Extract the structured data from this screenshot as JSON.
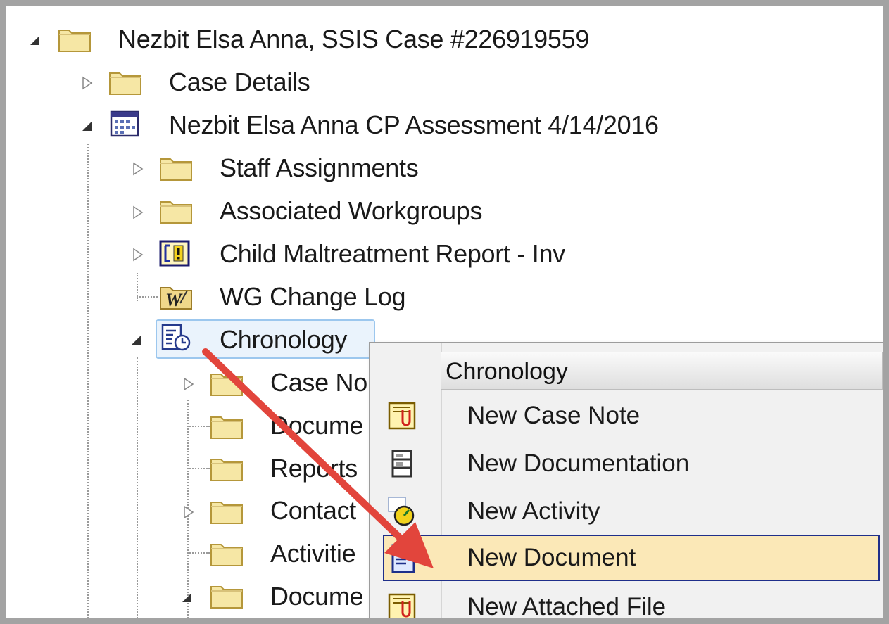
{
  "tree": {
    "items": [
      {
        "label": "Nezbit Elsa Anna, SSIS Case #226919559",
        "icon": "folder-icon",
        "expander": "expanded"
      },
      {
        "label": "Case Details",
        "icon": "folder-icon",
        "expander": "collapsed"
      },
      {
        "label": "Nezbit Elsa Anna CP Assessment 4/14/2016",
        "icon": "assessment-icon",
        "expander": "expanded"
      },
      {
        "label": "Staff Assignments",
        "icon": "folder-icon",
        "expander": "collapsed"
      },
      {
        "label": "Associated Workgroups",
        "icon": "folder-icon",
        "expander": "collapsed"
      },
      {
        "label": "Child Maltreatment Report - Inv",
        "icon": "maltreatment-report-icon",
        "expander": "collapsed"
      },
      {
        "label": "WG Change Log",
        "icon": "change-log-icon",
        "expander": "none"
      },
      {
        "label": "Chronology",
        "icon": "chronology-icon",
        "expander": "expanded",
        "selected": true
      },
      {
        "label": "Case No",
        "icon": "folder-icon",
        "expander": "collapsed"
      },
      {
        "label": "Docume",
        "icon": "folder-icon",
        "expander": "none"
      },
      {
        "label": "Reports",
        "icon": "folder-icon",
        "expander": "none"
      },
      {
        "label": "Contact",
        "icon": "folder-icon",
        "expander": "collapsed"
      },
      {
        "label": "Activitie",
        "icon": "folder-icon",
        "expander": "none"
      },
      {
        "label": "Docume",
        "icon": "folder-icon",
        "expander": "expanded"
      }
    ]
  },
  "context_menu": {
    "header": "Chronology",
    "items": [
      {
        "label": "New Case Note",
        "icon": "case-note-icon"
      },
      {
        "label": "New Documentation",
        "icon": "documentation-icon"
      },
      {
        "label": "New Activity",
        "icon": "activity-icon"
      },
      {
        "label": "New Document",
        "icon": "document-icon",
        "highlighted": true
      },
      {
        "label": "New Attached File",
        "icon": "attached-file-icon"
      }
    ]
  },
  "colors": {
    "folder": "#f6e7a5",
    "folder_border": "#b5973a",
    "selection_bg": "#eaf3fc",
    "menu_highlight": "#fbe8b7",
    "menu_highlight_border": "#1f2f8a",
    "arrow": "#e2453c"
  }
}
